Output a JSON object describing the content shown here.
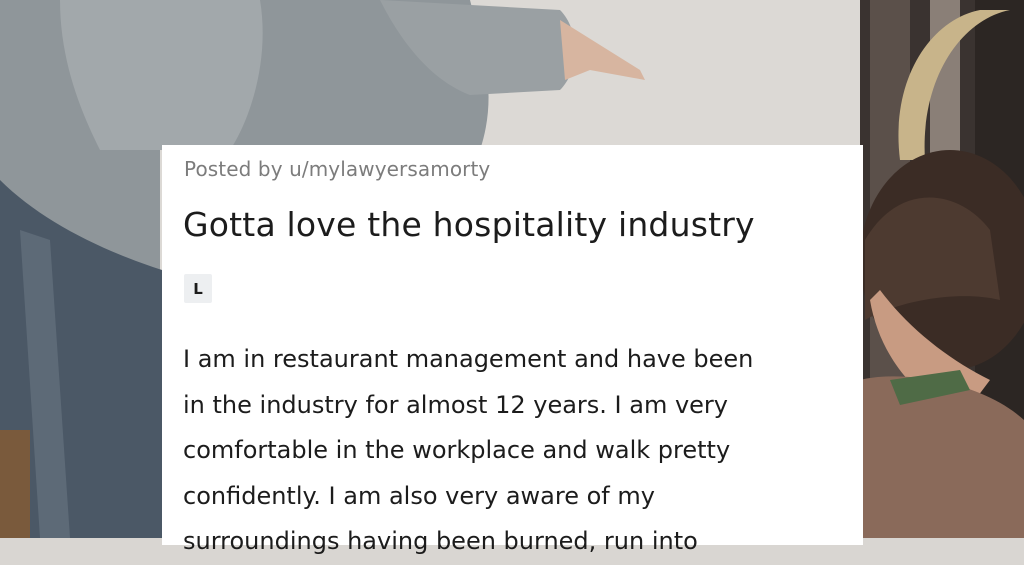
{
  "post": {
    "posted_by": "Posted by u/mylawyersamorty",
    "title": "Gotta love the hospitality industry",
    "flair": "L",
    "body_lines": [
      "I am in restaurant management and have been",
      "in the industry for almost 12 years. I am very",
      "comfortable in the workplace and walk pretty",
      "confidently. I am also very aware of my",
      "surroundings having been burned, run into"
    ]
  }
}
